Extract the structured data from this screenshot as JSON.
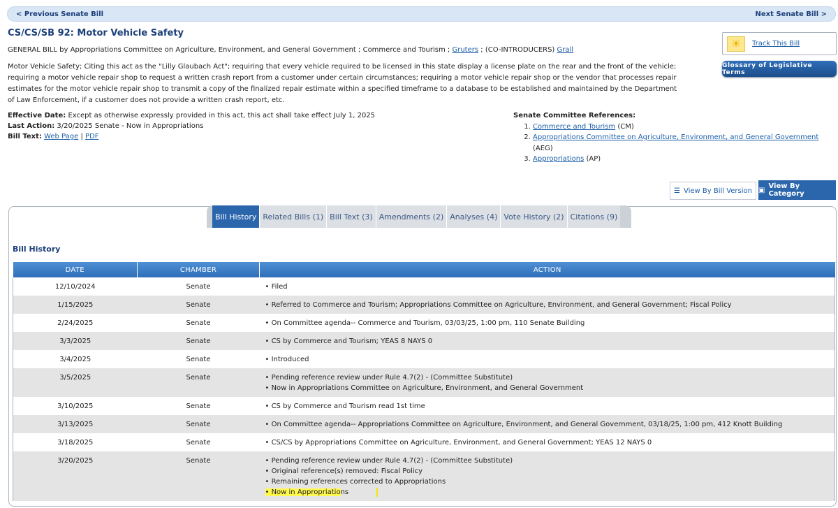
{
  "nav": {
    "prev": "< Previous Senate Bill",
    "next": "Next Senate Bill >"
  },
  "bill": {
    "title": "CS/CS/SB 92: Motor Vehicle Safety",
    "type_prefix": "GENERAL BILL by Appropriations Committee on Agriculture, Environment, and General Government ; Commerce and Tourism ;",
    "sponsor": "Gruters",
    "coint_label": "; (CO-INTRODUCERS)",
    "cointroducer": "Grall",
    "summary": "Motor Vehicle Safety; Citing this act as the \"Lilly Glaubach Act\"; requiring that every vehicle required to be licensed in this state display a license plate on the rear and the front of the vehicle; requiring a motor vehicle repair shop to request a written crash report from a customer under certain circumstances; requiring a motor vehicle repair shop or the vendor that processes repair estimates for the motor vehicle repair shop to transmit a copy of the finalized repair estimate within a specified timeframe to a database to be established and maintained by the Department of Law Enforcement, if a customer does not provide a written crash report, etc."
  },
  "side": {
    "track": "Track This Bill",
    "glossary": "Glossary of Legislative Terms"
  },
  "meta": {
    "effective_label": "Effective Date:",
    "effective_value": "Except as otherwise expressly provided in this act, this act shall take effect July 1, 2025",
    "last_action_label": "Last Action:",
    "last_action_value": "3/20/2025 Senate - Now in Appropriations",
    "bill_text_label": "Bill Text:",
    "bill_text_web": "Web Page",
    "bill_text_sep": "|",
    "bill_text_pdf": "PDF"
  },
  "refs": {
    "heading": "Senate Committee References:",
    "items": [
      {
        "name": "Commerce and Tourism",
        "abbr": "(CM)"
      },
      {
        "name": "Appropriations Committee on Agriculture, Environment, and General Government",
        "abbr": "(AEG)"
      },
      {
        "name": "Appropriations",
        "abbr": "(AP)"
      }
    ]
  },
  "view_buttons": {
    "by_version": "View By Bill Version",
    "by_category": "View By Category"
  },
  "tabs": [
    {
      "label": "Bill History",
      "active": true
    },
    {
      "label": "Related Bills (1)"
    },
    {
      "label": "Bill Text (3)"
    },
    {
      "label": "Amendments (2)"
    },
    {
      "label": "Analyses (4)"
    },
    {
      "label": "Vote History (2)"
    },
    {
      "label": "Citations (9)"
    }
  ],
  "history": {
    "title": "Bill History",
    "headers": {
      "date": "DATE",
      "chamber": "CHAMBER",
      "action": "ACTION"
    },
    "rows": [
      {
        "date": "12/10/2024",
        "chamber": "Senate",
        "actions": [
          "• Filed"
        ]
      },
      {
        "date": "1/15/2025",
        "chamber": "Senate",
        "actions": [
          "• Referred to Commerce and Tourism; Appropriations Committee on Agriculture, Environment, and General Government; Fiscal Policy"
        ]
      },
      {
        "date": "2/24/2025",
        "chamber": "Senate",
        "actions": [
          "• On Committee agenda-- Commerce and Tourism, 03/03/25, 1:00 pm, 110 Senate Building"
        ]
      },
      {
        "date": "3/3/2025",
        "chamber": "Senate",
        "actions": [
          "• CS by Commerce and Tourism; YEAS 8 NAYS 0"
        ]
      },
      {
        "date": "3/4/2025",
        "chamber": "Senate",
        "actions": [
          "• Introduced"
        ]
      },
      {
        "date": "3/5/2025",
        "chamber": "Senate",
        "actions": [
          "• Pending reference review under Rule 4.7(2) - (Committee Substitute)",
          "• Now in Appropriations Committee on Agriculture, Environment, and General Government"
        ]
      },
      {
        "date": "3/10/2025",
        "chamber": "Senate",
        "actions": [
          "• CS by Commerce and Tourism read 1st time"
        ]
      },
      {
        "date": "3/13/2025",
        "chamber": "Senate",
        "actions": [
          "• On Committee agenda-- Appropriations Committee on Agriculture, Environment, and General Government, 03/18/25, 1:00 pm, 412 Knott Building"
        ]
      },
      {
        "date": "3/18/2025",
        "chamber": "Senate",
        "actions": [
          "• CS/CS by Appropriations Committee on Agriculture, Environment, and General Government; YEAS 12 NAYS 0"
        ]
      },
      {
        "date": "3/20/2025",
        "chamber": "Senate",
        "actions": [
          "• Pending reference review under Rule 4.7(2) - (Committee Substitute)",
          "• Original reference(s) removed: Fiscal Policy",
          "• Remaining references corrected to Appropriations",
          "• Now in Appropriations"
        ]
      }
    ],
    "highlight": {
      "row": 9,
      "line": 3,
      "marked": "• Now in Appropriatio",
      "rest": "ns"
    }
  }
}
